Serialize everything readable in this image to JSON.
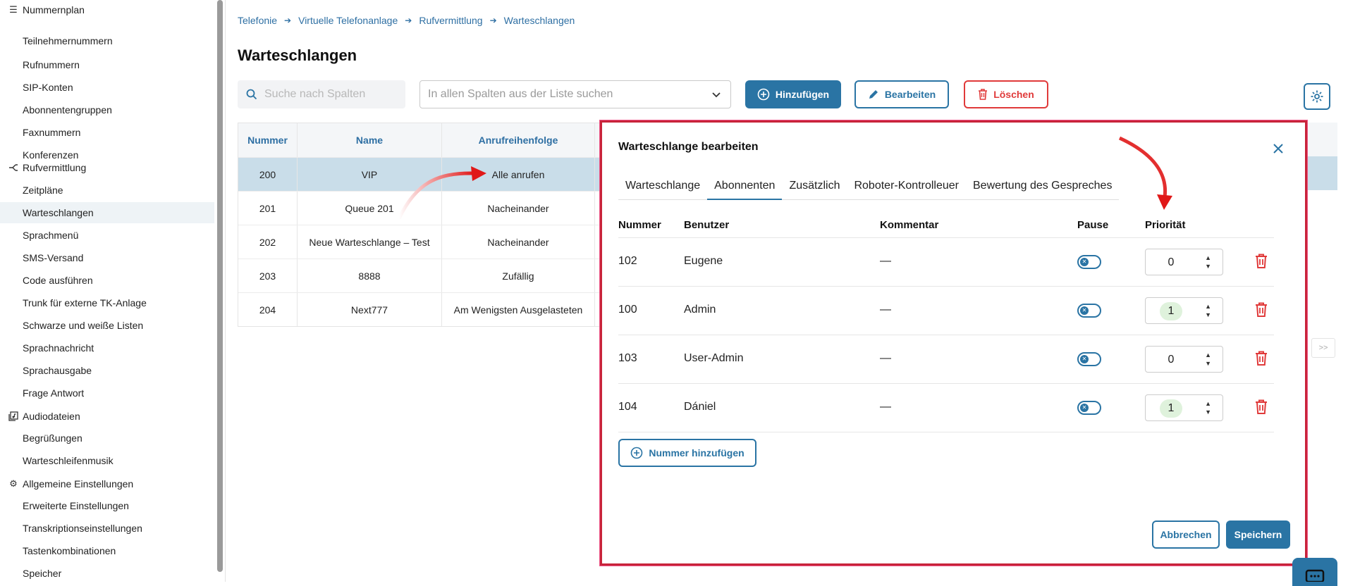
{
  "sidebar": {
    "sections": [
      {
        "label": "Nummernplan",
        "icon": "list-icon"
      },
      {
        "label": "Rufvermittlung",
        "icon": "routing-icon"
      },
      {
        "label": "Audiodateien",
        "icon": "audio-files-icon"
      },
      {
        "label": "Allgemeine Einstellungen",
        "icon": "gear-icon"
      }
    ],
    "items": [
      "Teilnehmernummern",
      "Rufnummern",
      "SIP-Konten",
      "Abonnentengruppen",
      "Faxnummern",
      "Konferenzen",
      "Zeitpläne",
      "Warteschlangen",
      "Sprachmenü",
      "SMS-Versand",
      "Code ausführen",
      "Trunk für externe TK-Anlage",
      "Schwarze und weiße Listen",
      "Sprachnachricht",
      "Sprachausgabe",
      "Frage Antwort",
      "Begrüßungen",
      "Warteschleifenmusik",
      "Erweiterte Einstellungen",
      "Transkriptionseinstellungen",
      "Tastenkombinationen",
      "Speicher"
    ]
  },
  "breadcrumb": [
    "Telefonie",
    "Virtuelle Telefonanlage",
    "Rufvermittlung",
    "Warteschlangen"
  ],
  "page_title": "Warteschlangen",
  "toolbar": {
    "search_placeholder": "Suche nach Spalten",
    "select_placeholder": "In allen Spalten aus der Liste suchen",
    "add_label": "Hinzufügen",
    "edit_label": "Bearbeiten",
    "delete_label": "Löschen"
  },
  "table": {
    "headers": [
      "Nummer",
      "Name",
      "Anrufreihenfolge"
    ],
    "rows": [
      {
        "nummer": "200",
        "name": "VIP",
        "order": "Alle anrufen",
        "selected": true
      },
      {
        "nummer": "201",
        "name": "Queue 201",
        "order": "Nacheinander"
      },
      {
        "nummer": "202",
        "name": "Neue Warteschlange – Test",
        "order": "Nacheinander"
      },
      {
        "nummer": "203",
        "name": "8888",
        "order": "Zufällig"
      },
      {
        "nummer": "204",
        "name": "Next777",
        "order": "Am Wenigsten Ausgelasteten"
      }
    ]
  },
  "pager": {
    "next_label": ">>"
  },
  "modal": {
    "title": "Warteschlange bearbeiten",
    "tabs": [
      "Warteschlange",
      "Abonnenten",
      "Zusätzlich",
      "Roboter-Kontrolleuer",
      "Bewertung des Gespreches"
    ],
    "active_tab": 1,
    "columns": [
      "Nummer",
      "Benutzer",
      "Kommentar",
      "Pause",
      "Priorität"
    ],
    "rows": [
      {
        "nummer": "102",
        "benutzer": "Eugene",
        "kommentar": "—",
        "pause": false,
        "prioritaet": "0"
      },
      {
        "nummer": "100",
        "benutzer": "Admin",
        "kommentar": "—",
        "pause": false,
        "prioritaet": "1"
      },
      {
        "nummer": "103",
        "benutzer": "User-Admin",
        "kommentar": "—",
        "pause": false,
        "prioritaet": "0"
      },
      {
        "nummer": "104",
        "benutzer": "Dániel",
        "kommentar": "—",
        "pause": false,
        "prioritaet": "1"
      }
    ],
    "add_number_label": "Nummer hinzufügen",
    "cancel_label": "Abbrechen",
    "save_label": "Speichern"
  },
  "colors": {
    "accent": "#2a74a4",
    "danger": "#e03a3a",
    "annotation": "#c8243a",
    "selected_row": "#c9dde9"
  }
}
